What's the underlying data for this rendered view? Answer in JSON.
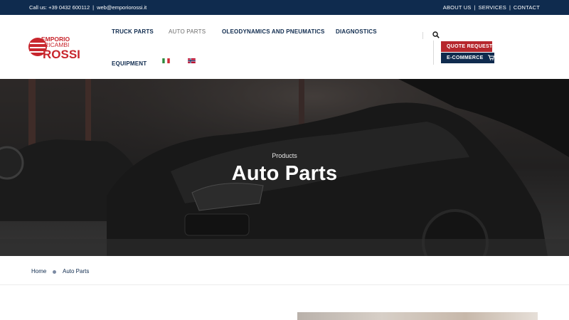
{
  "topbar": {
    "phone": "Call us: +39 0432 600112",
    "email": "web@emporiorossi.it",
    "links": [
      "ABOUT US",
      "SERVICES",
      "CONTACT"
    ]
  },
  "logo": {
    "line1": "EMPORIO",
    "line2": "RICAMBI",
    "line3": "ROSSI",
    "brand_color": "#c8262d"
  },
  "nav": {
    "truck_parts": "TRUCK PARTS",
    "auto_parts": "AUTO PARTS",
    "oleodynamics": "OLEODYNAMICS AND PNEUMATICS",
    "diagnostics": "DIAGNOSTICS",
    "equipment": "EQUIPMENT"
  },
  "icons": {
    "search": "search-icon",
    "cart": "cart-icon",
    "flag_it": "italy-flag-icon",
    "flag_no": "norway-flag-icon"
  },
  "buttons": {
    "quote": "QUOTE REQUEST",
    "ecommerce": "E-COMMERCE"
  },
  "hero": {
    "subtitle": "Products",
    "title": "Auto Parts"
  },
  "breadcrumb": {
    "home": "Home",
    "current": "Auto Parts"
  },
  "colors": {
    "navy": "#0f2b4e",
    "red": "#b6272d",
    "accent_blue": "#7b8aa3"
  }
}
